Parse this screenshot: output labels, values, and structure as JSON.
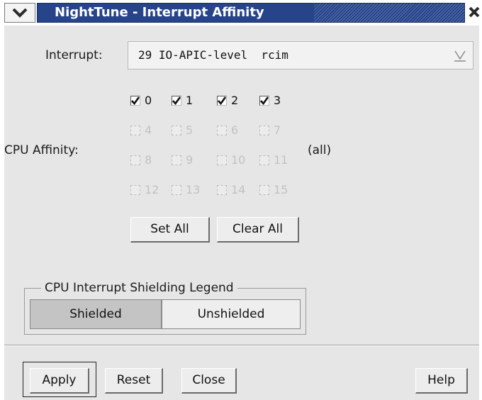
{
  "window": {
    "title": "NightTune - Interrupt Affinity",
    "menu_icon": "chevron-down-icon",
    "close_icon": "close-icon"
  },
  "interrupt": {
    "label": "Interrupt:",
    "value": "29 IO-APIC-level  rcim"
  },
  "cpu_affinity": {
    "label": "CPU Affinity:",
    "summary": "(all)",
    "cpus": [
      {
        "label": "0",
        "checked": true,
        "enabled": true
      },
      {
        "label": "1",
        "checked": true,
        "enabled": true
      },
      {
        "label": "2",
        "checked": true,
        "enabled": true
      },
      {
        "label": "3",
        "checked": true,
        "enabled": true
      },
      {
        "label": "4",
        "checked": false,
        "enabled": false
      },
      {
        "label": "5",
        "checked": false,
        "enabled": false
      },
      {
        "label": "6",
        "checked": false,
        "enabled": false
      },
      {
        "label": "7",
        "checked": false,
        "enabled": false
      },
      {
        "label": "8",
        "checked": false,
        "enabled": false
      },
      {
        "label": "9",
        "checked": false,
        "enabled": false
      },
      {
        "label": "10",
        "checked": false,
        "enabled": false
      },
      {
        "label": "11",
        "checked": false,
        "enabled": false
      },
      {
        "label": "12",
        "checked": false,
        "enabled": false
      },
      {
        "label": "13",
        "checked": false,
        "enabled": false
      },
      {
        "label": "14",
        "checked": false,
        "enabled": false
      },
      {
        "label": "15",
        "checked": false,
        "enabled": false
      }
    ],
    "set_all_label": "Set All",
    "clear_all_label": "Clear All"
  },
  "legend": {
    "title": "CPU Interrupt Shielding Legend",
    "shielded_label": "Shielded",
    "unshielded_label": "Unshielded",
    "shielded_color": "#c4c4c4",
    "unshielded_color": "#eeeeee"
  },
  "footer": {
    "apply_label": "Apply",
    "reset_label": "Reset",
    "close_label": "Close",
    "help_label": "Help"
  },
  "colors": {
    "titlebar": "#27448a",
    "background": "#e6e6e6"
  }
}
